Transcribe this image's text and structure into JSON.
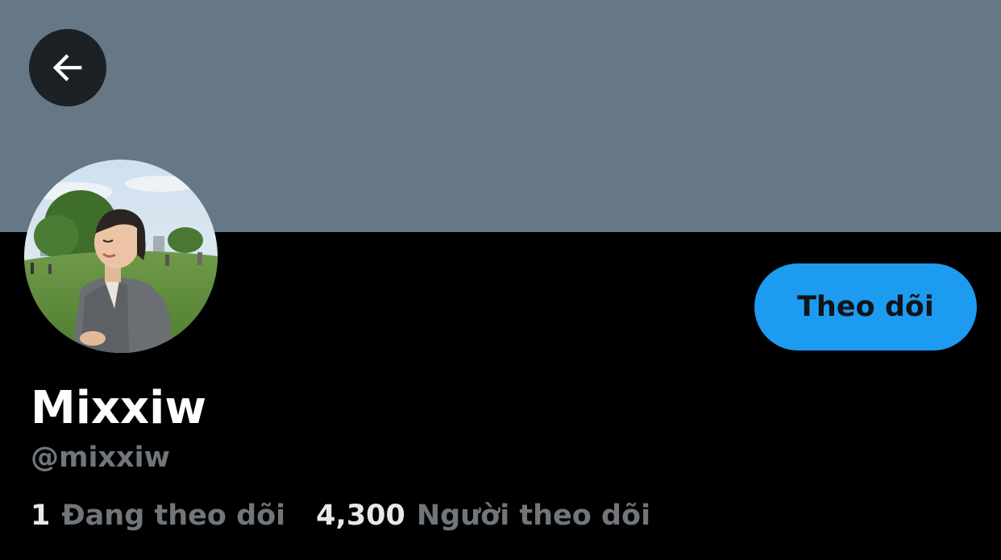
{
  "header": {
    "back_icon": "arrow-left-icon",
    "banner_color": "#667786"
  },
  "profile": {
    "display_name": "Mixxiw",
    "handle": "@mixxiw",
    "follow_button_label": "Theo dõi",
    "accent_color": "#1d9bf0"
  },
  "stats": {
    "following_count": "1",
    "following_label": "Đang theo dõi",
    "followers_count": "4,300",
    "followers_label": "Người theo dõi"
  }
}
